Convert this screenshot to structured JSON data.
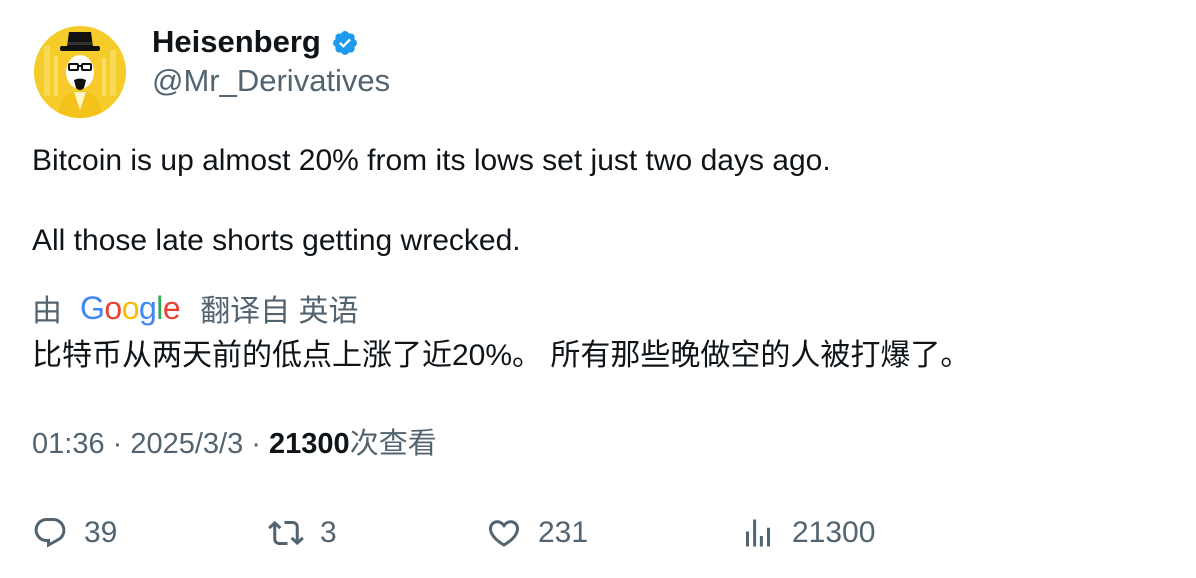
{
  "author": {
    "display_name": "Heisenberg",
    "handle": "@Mr_Derivatives",
    "verified": true,
    "verified_color": "#1d9bf0",
    "avatar_icon": "heisenberg-avatar"
  },
  "tweet": {
    "line1": "Bitcoin is up almost 20% from its lows set just two days ago.",
    "line2": "All those late shorts getting wrecked."
  },
  "translation": {
    "by_label": "由",
    "provider_logo_letters": [
      "G",
      "o",
      "o",
      "g",
      "l",
      "e"
    ],
    "provider_logo_colors": [
      "#4285F4",
      "#EA4335",
      "#FBBC05",
      "#4285F4",
      "#34A853",
      "#EA4335"
    ],
    "from_label": "翻译自 英语",
    "text": "比特币从两天前的低点上涨了近20%。 所有那些晚做空的人被打爆了。"
  },
  "meta": {
    "time": "01:36",
    "separator": " · ",
    "date": "2025/3/3",
    "views_count": "21300",
    "views_label": "次查看"
  },
  "actions": {
    "replies": "39",
    "retweets": "3",
    "likes": "231",
    "views": "21300"
  }
}
